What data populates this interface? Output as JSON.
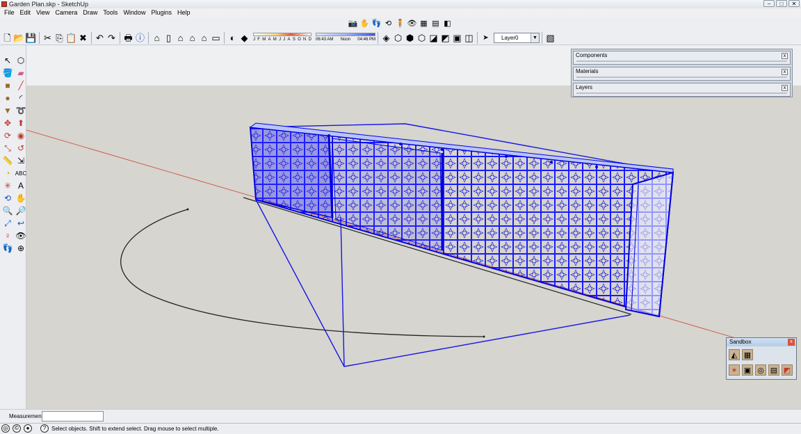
{
  "window": {
    "title": "Garden Plan.skp - SketchUp",
    "minimize": "–",
    "maximize": "□",
    "close": "✕"
  },
  "menu": [
    "File",
    "Edit",
    "View",
    "Camera",
    "Draw",
    "Tools",
    "Window",
    "Plugins",
    "Help"
  ],
  "shadow": {
    "months": [
      "J",
      "F",
      "M",
      "A",
      "M",
      "J",
      "J",
      "A",
      "S",
      "O",
      "N",
      "D"
    ],
    "time_start": "06:43 AM",
    "time_mid": "Noon",
    "time_end": "04:46 PM"
  },
  "layer": {
    "current": "Layer0"
  },
  "tray": {
    "panels": [
      {
        "title": "Components"
      },
      {
        "title": "Materials"
      },
      {
        "title": "Layers"
      }
    ],
    "close_glyph": "x"
  },
  "sandbox": {
    "title": "Sandbox",
    "close": "x"
  },
  "measurements": {
    "label": "Measurements",
    "value": ""
  },
  "status": {
    "message": "Select objects. Shift to extend select. Drag mouse to select multiple."
  },
  "icons": {
    "toolbar_top": [
      "camera-icon",
      "pan-icon",
      "walk-icon",
      "orbit-icon",
      "position-camera-icon",
      "look-around-icon",
      "section-icon"
    ],
    "toolbar_std": [
      "new-icon",
      "open-icon",
      "save-icon",
      "cut-icon",
      "copy-icon",
      "paste-icon",
      "erase-icon",
      "undo-icon",
      "redo-icon",
      "print-icon",
      "model-info-icon"
    ],
    "toolbar_views": [
      "iso-view-icon",
      "top-view-icon",
      "front-view-icon",
      "right-view-icon",
      "back-view-icon",
      "left-view-icon"
    ],
    "toolbar_styles": [
      "xray-icon",
      "wireframe-icon",
      "hidden-line-icon",
      "shaded-icon",
      "shaded-textures-icon",
      "monochrome-icon"
    ],
    "left_tools": [
      "select-icon",
      "make-component-icon",
      "paint-bucket-icon",
      "eraser-icon",
      "rectangle-icon",
      "line-icon",
      "circle-icon",
      "arc-icon",
      "polygon-icon",
      "freehand-icon",
      "move-icon",
      "push-pull-icon",
      "rotate-icon",
      "follow-me-icon",
      "scale-icon",
      "offset-icon",
      "tape-measure-icon",
      "dimension-icon",
      "protractor-icon",
      "text-icon",
      "axes-icon",
      "3d-text-icon",
      "orbit-icon",
      "pan-icon",
      "zoom-icon",
      "zoom-window-icon",
      "zoom-extents-icon",
      "previous-view-icon",
      "position-camera-icon",
      "look-around-icon",
      "walk-icon",
      "section-plane-icon"
    ],
    "sandbox_tools": [
      "from-contours-icon",
      "from-scratch-icon",
      "smoove-icon",
      "stamp-icon",
      "drape-icon",
      "add-detail-icon",
      "flip-edge-icon"
    ]
  }
}
